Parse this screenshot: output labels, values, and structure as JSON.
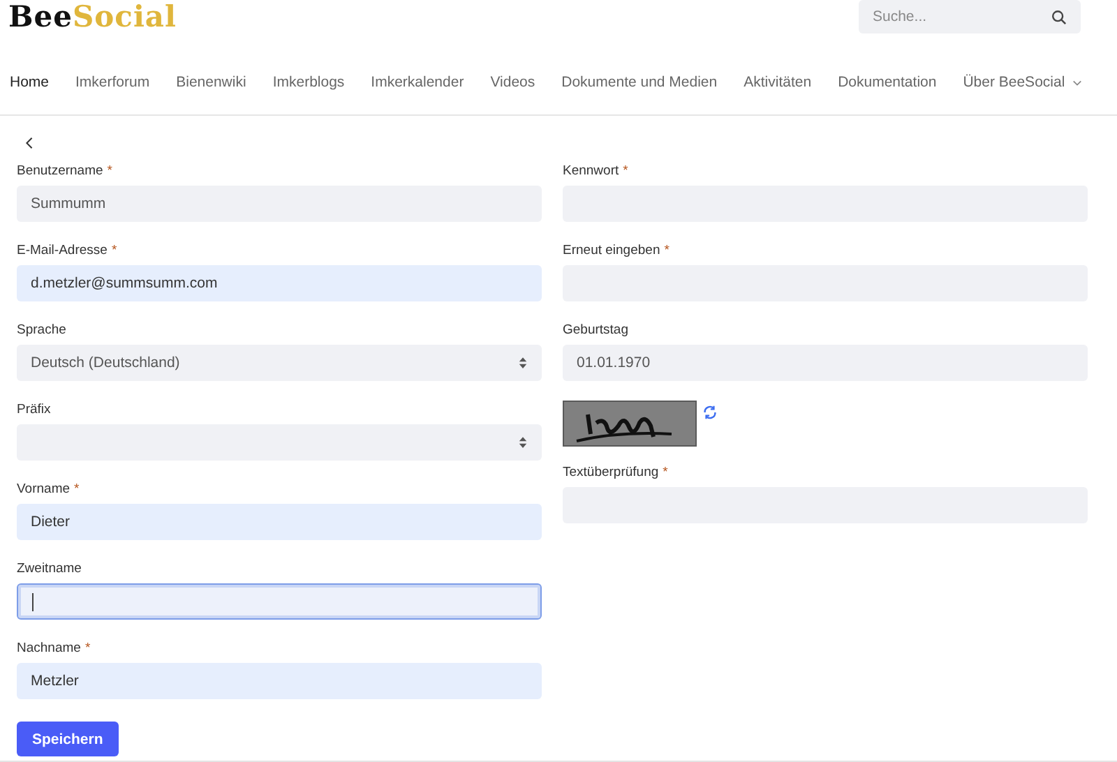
{
  "logo": {
    "part_1": "Bee",
    "part_2": "Social"
  },
  "search": {
    "placeholder": "Suche..."
  },
  "nav": [
    {
      "label": "Home",
      "selected": true,
      "dropdown": false
    },
    {
      "label": "Imkerforum",
      "selected": false,
      "dropdown": false
    },
    {
      "label": "Bienenwiki",
      "selected": false,
      "dropdown": false
    },
    {
      "label": "Imkerblogs",
      "selected": false,
      "dropdown": false
    },
    {
      "label": "Imkerkalender",
      "selected": false,
      "dropdown": false
    },
    {
      "label": "Videos",
      "selected": false,
      "dropdown": false
    },
    {
      "label": "Dokumente und Medien",
      "selected": false,
      "dropdown": false
    },
    {
      "label": "Aktivitäten",
      "selected": false,
      "dropdown": false
    },
    {
      "label": "Dokumentation",
      "selected": false,
      "dropdown": false
    },
    {
      "label": "Über BeeSocial",
      "selected": false,
      "dropdown": true
    }
  ],
  "left_fields": [
    {
      "kind": "text",
      "label": "Benutzername",
      "required_mark": "*",
      "value": "Summumm",
      "autofilled": false,
      "focused": false
    },
    {
      "kind": "text",
      "label": "E-Mail-Adresse",
      "required_mark": "*",
      "value": "d.metzler@summsumm.com",
      "autofilled": true,
      "focused": false
    },
    {
      "kind": "select",
      "label": "Sprache",
      "value": "Deutsch (Deutschland)",
      "autofilled": false,
      "focused": false
    },
    {
      "kind": "select",
      "label": "Präfix",
      "focused": false
    },
    {
      "kind": "text",
      "label": "Vorname",
      "required_mark": "*",
      "value": "Dieter",
      "autofilled": true,
      "focused": false
    },
    {
      "kind": "text",
      "label": "Zweitname",
      "autofilled": false,
      "focused": true
    },
    {
      "kind": "text",
      "label": "Nachname",
      "required_mark": "*",
      "value": "Metzler",
      "autofilled": true,
      "focused": false
    }
  ],
  "right_fields": [
    {
      "kind": "text",
      "label": "Kennwort",
      "required_mark": "*",
      "focused": false
    },
    {
      "kind": "text",
      "label": "Erneut eingeben",
      "required_mark": "*",
      "focused": false
    },
    {
      "kind": "text",
      "label": "Geburtstag",
      "value": "01.01.1970",
      "autofilled": false,
      "focused": false
    },
    {
      "kind": "captcha"
    },
    {
      "kind": "text",
      "label": "Textüberprüfung",
      "required_mark": "*",
      "focused": false
    }
  ],
  "save_button": "Speichern"
}
